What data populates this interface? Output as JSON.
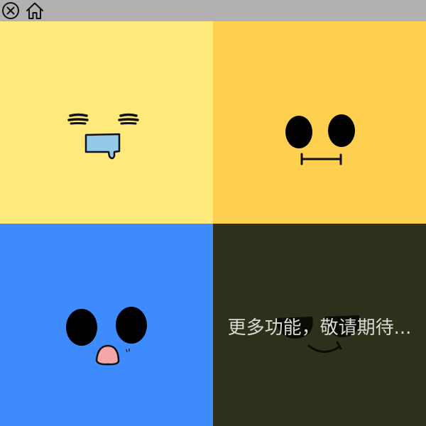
{
  "topbar": {
    "close_icon": "close-circle-icon",
    "home_icon": "home-icon",
    "background": "#b2b0b0"
  },
  "tiles": [
    {
      "name": "sleepy-drool-face",
      "color": "#ffe97a"
    },
    {
      "name": "neutral-face",
      "color": "#ffd04f"
    },
    {
      "name": "surprised-pink-nose-face",
      "color": "#3d8bfd"
    },
    {
      "name": "sunglasses-smile-face",
      "color": "#2e301c"
    }
  ],
  "overlay": {
    "text": "更多功能，敬请期待..."
  }
}
